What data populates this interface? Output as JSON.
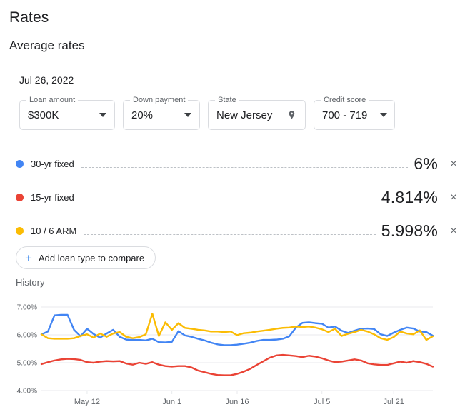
{
  "header": {
    "title": "Rates",
    "subtitle": "Average rates",
    "date": "Jul 26, 2022"
  },
  "filters": [
    {
      "name": "loan-amount",
      "label": "Loan amount",
      "value": "$300K",
      "icon": "chevron-down-icon"
    },
    {
      "name": "down-payment",
      "label": "Down payment",
      "value": "20%",
      "icon": "chevron-down-icon"
    },
    {
      "name": "state",
      "label": "State",
      "value": "New Jersey",
      "icon": "location-pin-icon"
    },
    {
      "name": "credit-score",
      "label": "Credit score",
      "value": "700 - 719",
      "icon": "chevron-down-icon"
    }
  ],
  "loan_rows": [
    {
      "label": "30-yr fixed",
      "rate": "6%",
      "color": "#4285F4",
      "remove": "×"
    },
    {
      "label": "15-yr fixed",
      "rate": "4.814%",
      "color": "#EA4335",
      "remove": "×"
    },
    {
      "label": "10 / 6 ARM",
      "rate": "5.998%",
      "color": "#FBBC04",
      "remove": "×"
    }
  ],
  "add_button": {
    "plus": "+",
    "label": "Add loan type to compare"
  },
  "history_label": "History",
  "chart_data": {
    "type": "line",
    "title": "History",
    "xlabel": "",
    "ylabel": "",
    "ylim": [
      4.0,
      7.0
    ],
    "ytick_labels": [
      "7.00%",
      "6.00%",
      "5.00%",
      "4.00%"
    ],
    "ytick_values": [
      7.0,
      6.0,
      5.0,
      4.0
    ],
    "grid": true,
    "legend_position": "above-chart",
    "xtick_labels": [
      "May 12",
      "Jun 1",
      "Jun 16",
      "Jul 5",
      "Jul 21"
    ],
    "xtick_indices": [
      7,
      20,
      30,
      43,
      54
    ],
    "x_count": 61,
    "series": [
      {
        "name": "30-yr fixed",
        "color": "#4285F4",
        "values": [
          6.02,
          6.12,
          6.7,
          6.72,
          6.72,
          6.18,
          5.95,
          6.22,
          6.03,
          5.9,
          6.05,
          6.18,
          5.93,
          5.83,
          5.82,
          5.82,
          5.8,
          5.86,
          5.74,
          5.73,
          5.75,
          6.13,
          5.98,
          5.93,
          5.86,
          5.8,
          5.72,
          5.66,
          5.63,
          5.63,
          5.65,
          5.68,
          5.72,
          5.78,
          5.82,
          5.82,
          5.83,
          5.86,
          5.95,
          6.26,
          6.43,
          6.45,
          6.42,
          6.4,
          6.26,
          6.3,
          6.15,
          6.07,
          6.15,
          6.22,
          6.23,
          6.21,
          6.02,
          5.96,
          6.08,
          6.18,
          6.26,
          6.23,
          6.12,
          6.1,
          5.97
        ]
      },
      {
        "name": "15-yr fixed",
        "color": "#EA4335",
        "values": [
          4.95,
          5.02,
          5.08,
          5.12,
          5.14,
          5.13,
          5.1,
          5.02,
          5.0,
          5.04,
          5.06,
          5.05,
          5.06,
          4.97,
          4.93,
          5.0,
          4.96,
          5.02,
          4.93,
          4.88,
          4.86,
          4.88,
          4.88,
          4.83,
          4.72,
          4.66,
          4.6,
          4.56,
          4.55,
          4.55,
          4.6,
          4.68,
          4.78,
          4.92,
          5.05,
          5.18,
          5.26,
          5.28,
          5.26,
          5.24,
          5.2,
          5.25,
          5.22,
          5.16,
          5.08,
          5.02,
          5.04,
          5.08,
          5.12,
          5.08,
          4.98,
          4.94,
          4.92,
          4.92,
          4.98,
          5.04,
          5.0,
          5.06,
          5.02,
          4.96,
          4.86
        ]
      },
      {
        "name": "10 / 6 ARM",
        "color": "#FBBC04",
        "values": [
          6.02,
          5.88,
          5.86,
          5.86,
          5.86,
          5.88,
          5.96,
          6.02,
          5.9,
          6.05,
          5.93,
          6.05,
          6.1,
          5.93,
          5.88,
          5.92,
          6.02,
          6.76,
          5.96,
          6.45,
          6.18,
          6.42,
          6.25,
          6.22,
          6.18,
          6.16,
          6.12,
          6.12,
          6.1,
          6.12,
          5.99,
          6.06,
          6.08,
          6.12,
          6.15,
          6.18,
          6.22,
          6.25,
          6.26,
          6.3,
          6.28,
          6.3,
          6.26,
          6.2,
          6.1,
          6.22,
          5.96,
          6.04,
          6.1,
          6.18,
          6.12,
          6.02,
          5.88,
          5.82,
          5.92,
          6.12,
          6.05,
          6.02,
          6.16,
          5.82,
          5.95
        ]
      }
    ]
  }
}
